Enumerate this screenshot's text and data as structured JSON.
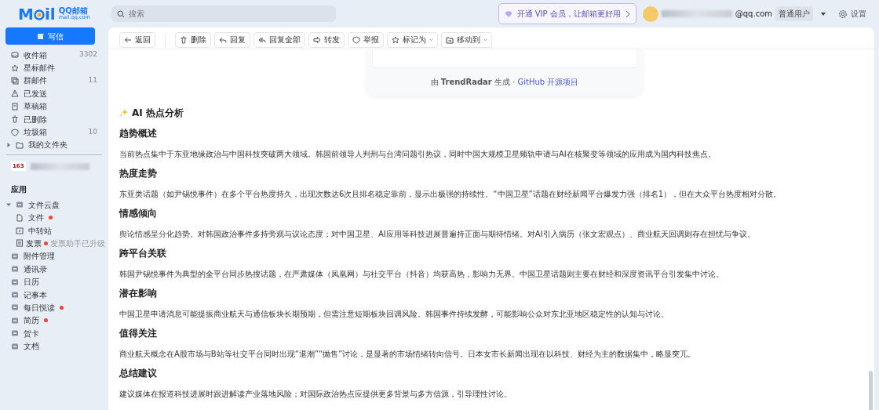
{
  "logo": {
    "left": "M",
    "right": "il",
    "brand": "QQ邮箱",
    "domain": "mail.qq.com"
  },
  "search": {
    "placeholder": "搜索"
  },
  "vip": {
    "label": "开通 VIP 会员，让邮箱更好用"
  },
  "user": {
    "email": "@qq.com",
    "badge": "普通用户"
  },
  "settings": {
    "label": "设置"
  },
  "compose": {
    "label": "写信"
  },
  "folders": [
    {
      "label": "收件箱",
      "kind": "inbox",
      "count": "3302"
    },
    {
      "label": "星标邮件",
      "kind": "star"
    },
    {
      "label": "群邮件",
      "kind": "group",
      "count": "11"
    },
    {
      "label": "已发送",
      "kind": "sent"
    },
    {
      "label": "草稿箱",
      "kind": "draft"
    },
    {
      "label": "已删除",
      "kind": "trash"
    },
    {
      "label": "垃圾箱",
      "kind": "shield",
      "count": "10"
    },
    {
      "label": "我的文件夹",
      "kind": "folder",
      "expanded": false
    }
  ],
  "account": {
    "badge": "163"
  },
  "apps": {
    "title": "应用",
    "items": [
      {
        "label": "文件云盘",
        "kind": "app",
        "expanded": true,
        "children": [
          {
            "label": "文件",
            "kind": "file",
            "dot": true
          },
          {
            "label": "中转站",
            "kind": "transfer",
            "dot": false
          },
          {
            "label": "发票",
            "kind": "invoice",
            "dot": true,
            "note": "发票助手已升级"
          }
        ]
      },
      {
        "label": "附件管理",
        "kind": "app",
        "dot": false
      },
      {
        "label": "通讯录",
        "kind": "app",
        "dot": false
      },
      {
        "label": "日历",
        "kind": "app",
        "dot": false
      },
      {
        "label": "记事本",
        "kind": "app",
        "dot": false
      },
      {
        "label": "每日悦读",
        "kind": "app",
        "dot": true
      },
      {
        "label": "简历",
        "kind": "app",
        "dot": true
      },
      {
        "label": "贺卡",
        "kind": "app",
        "dot": false
      },
      {
        "label": "文档",
        "kind": "app",
        "dot": false
      }
    ]
  },
  "toolbar": [
    {
      "label": "返回",
      "kind": "back",
      "dropdown": false
    },
    {
      "label": "删除",
      "kind": "trash",
      "dropdown": false
    },
    {
      "label": "回复",
      "kind": "reply",
      "dropdown": false
    },
    {
      "label": "回复全部",
      "kind": "replyall",
      "dropdown": false
    },
    {
      "label": "转发",
      "kind": "forward",
      "dropdown": false
    },
    {
      "label": "举报",
      "kind": "shield",
      "dropdown": false
    },
    {
      "label": "标记为",
      "kind": "star",
      "dropdown": true
    },
    {
      "label": "移动到",
      "kind": "move",
      "dropdown": true
    }
  ],
  "message": {
    "card_footer": "由 **TrendRadar** 生成 ·",
    "card_link": "GitHub 开源项目",
    "analysis_title": "AI 热点分析",
    "sections": [
      {
        "title": "趋势概述",
        "body": "当前热点集中于东亚地缘政治与中国科技突破两大领域。韩国前领导人判刑与台湾问题引热议，同时中国大规模卫星频轨申请与AI在核聚变等领域的应用成为国内科技焦点。"
      },
      {
        "title": "热度走势",
        "body": "东亚类话题（如尹锡悦事件）在多个平台热度持久，出现次数达6次且排名稳定靠前，显示出极强的持续性。“中国卫星”话题在财经新闻平台爆发力强（排名1），但在大众平台热度相对分散。"
      },
      {
        "title": "情感倾向",
        "body": "舆论情感呈分化趋势。对韩国政治事件多持旁观与议论态度；对中国卫星、AI应用等科技进展普遍持正面与期待情绪。对AI引入病历（张文宏观点）、商业航天回调则存在担忧与争议。"
      },
      {
        "title": "跨平台关联",
        "body": "韩国尹锡悦事件为典型的全平台同步热搜话题，在严肃媒体（凤凰网）与社交平台（抖音）均获高热，影响力无界。中国卫星话题则主要在财经和深度资讯平台引发集中讨论。"
      },
      {
        "title": "潜在影响",
        "body": "中国卫星申请消息可能提振商业航天与通信板块长期预期，但需注意短期板块回调风险。韩国事件持续发酵，可能影响公众对东北亚地区稳定性的认知与讨论。"
      },
      {
        "title": "值得关注",
        "body": "商业航天概念在A股市场与B站等社交平台同时出现“退潮”“抛售”讨论，是显著的市场情绪转向信号。日本女市长新闻出现在以科技、财经为主的数据集中，略显突兀。"
      },
      {
        "title": "总结建议",
        "body": "建议媒体在报道科技进展时跟进解读产业落地风险；对国际政治热点应提供更多背景与多方信源，引导理性讨论。"
      }
    ]
  }
}
